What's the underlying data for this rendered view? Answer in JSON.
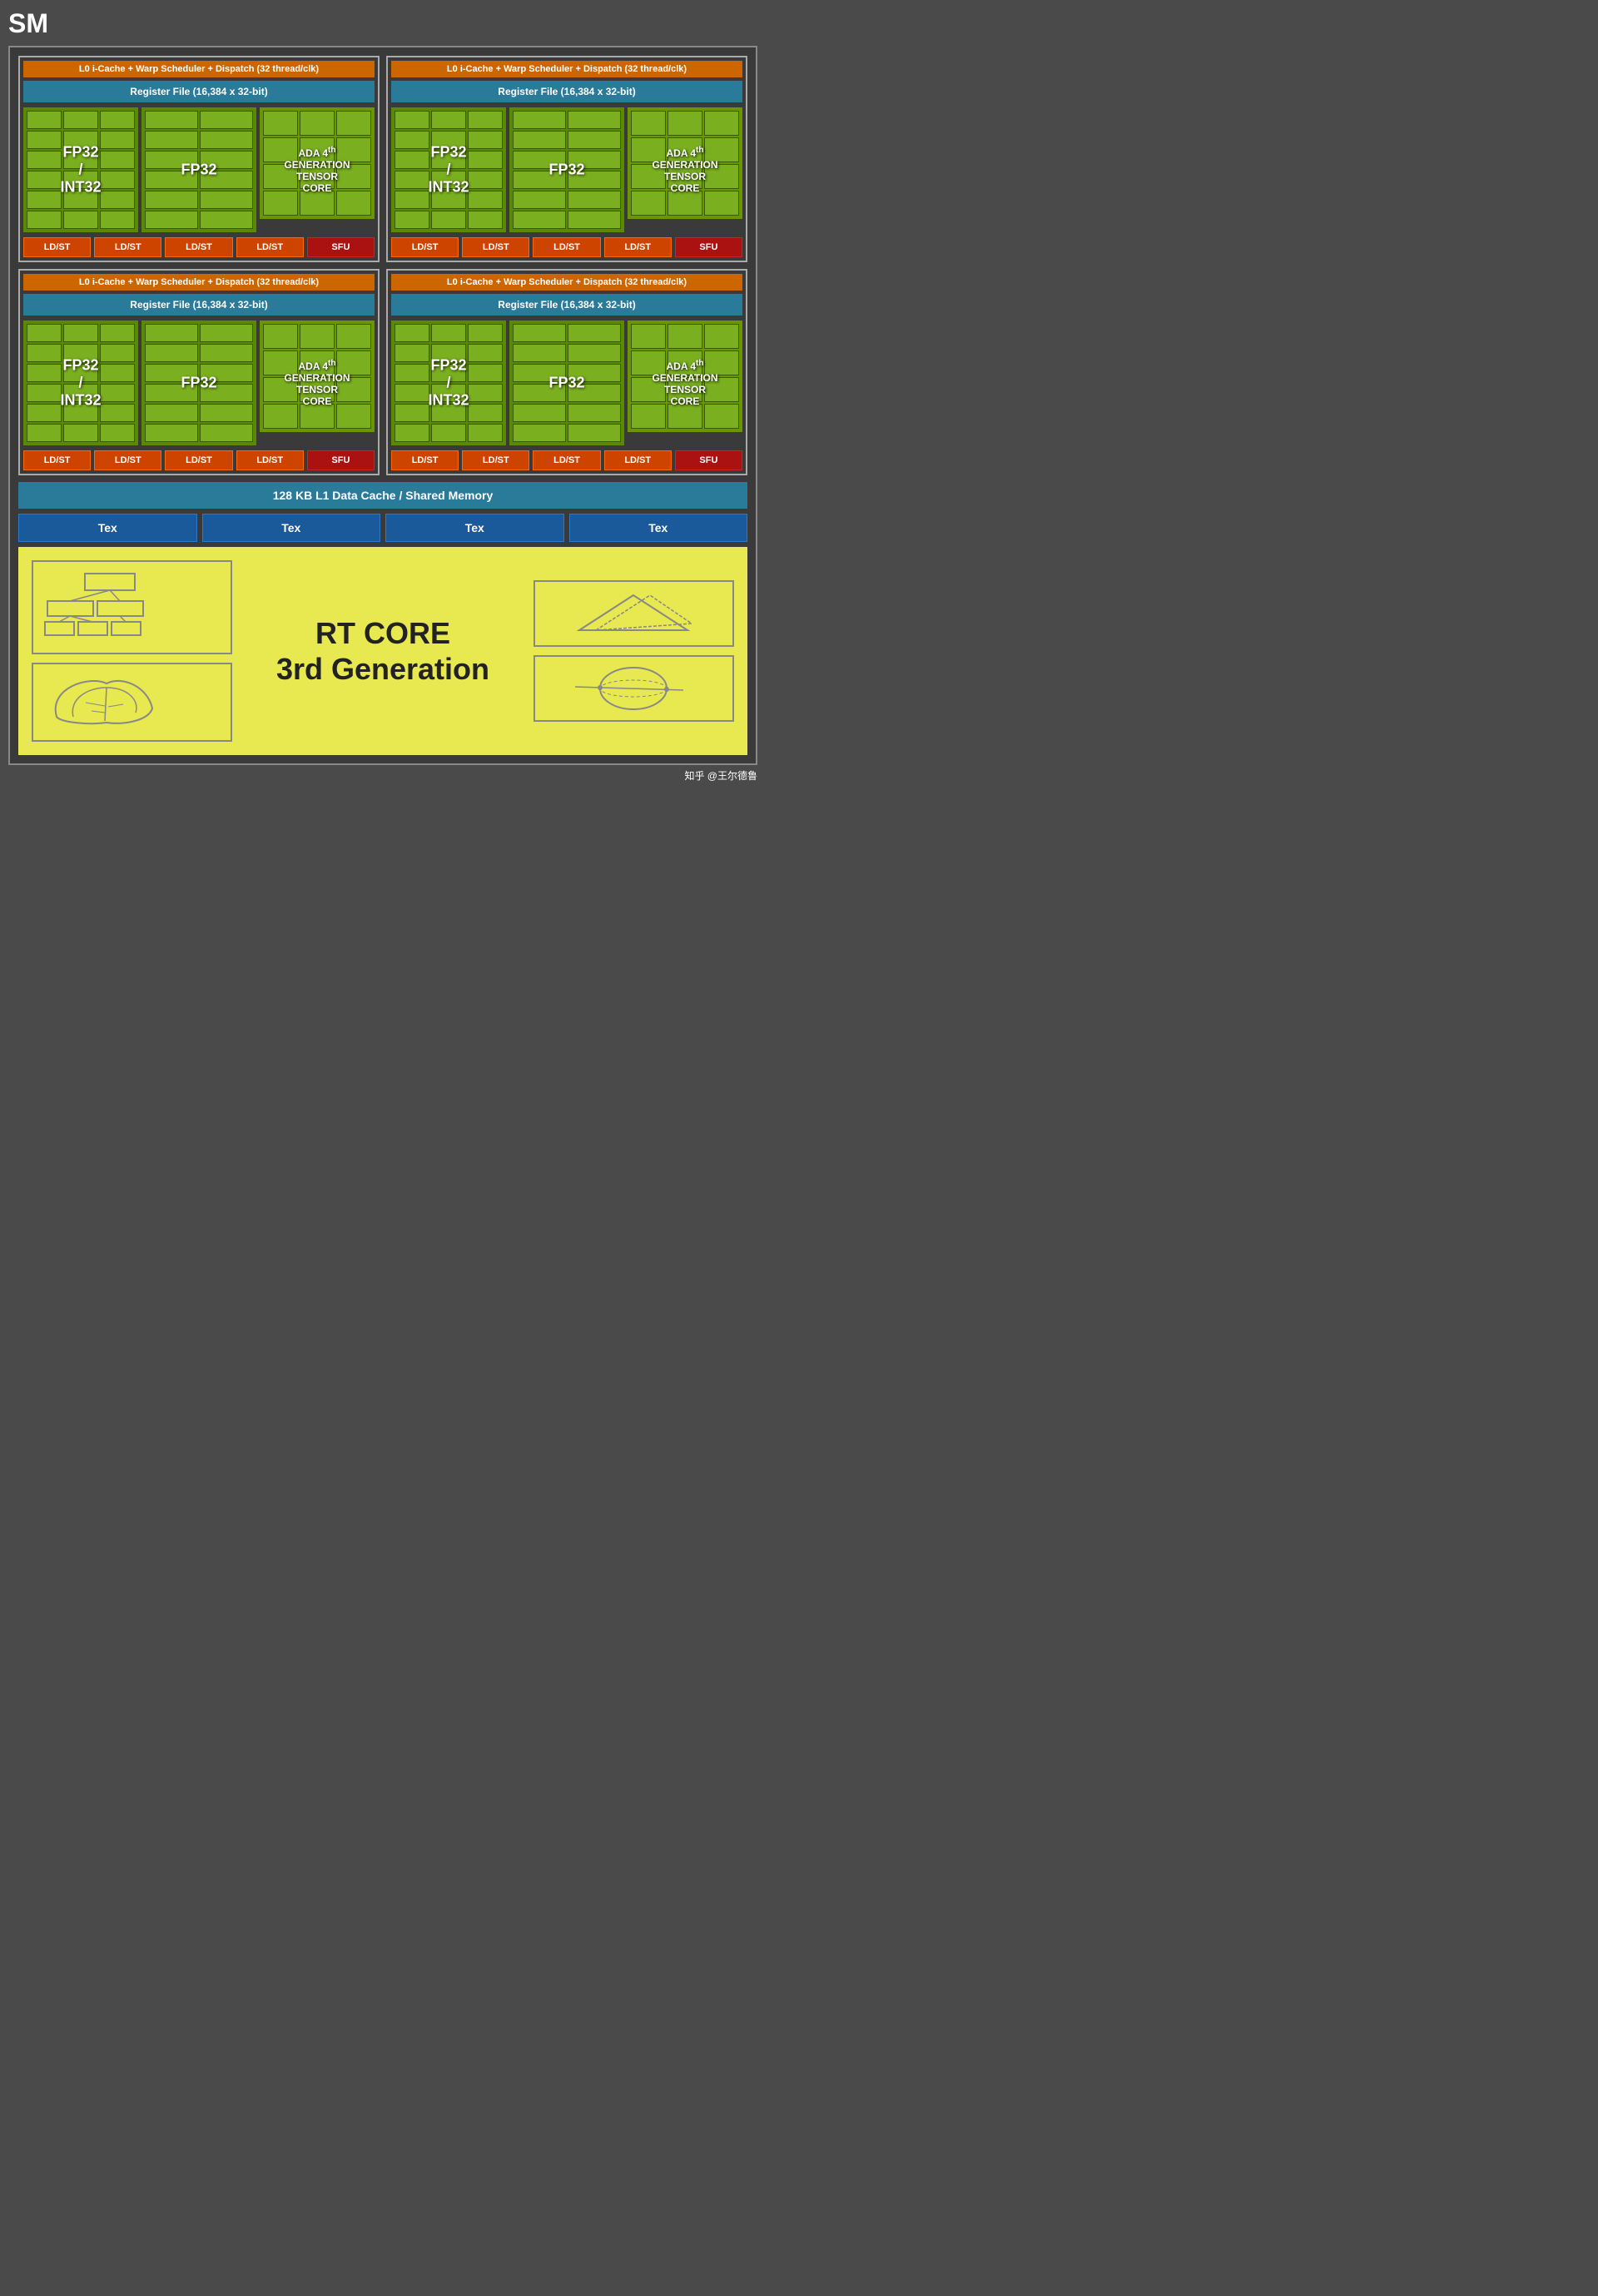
{
  "title": "SM",
  "colors": {
    "warp": "#cc6600",
    "register": "#2a7a9a",
    "green_dark": "#5a8800",
    "green_light": "#7ab020",
    "tensor": "#6a9600",
    "ldst": "#cc4400",
    "sfu": "#aa1111",
    "l1": "#2a7a9a",
    "tex": "#1a5a9a",
    "rt": "#e8e850",
    "border": "#888888"
  },
  "warp_label": "L0 i-Cache + Warp Scheduler + Dispatch (32 thread/clk)",
  "register_label": "Register File (16,384 x 32-bit)",
  "fp32_int32_label": "FP32\n/\nINT32",
  "fp32_label": "FP32",
  "tensor_label": "ADA 4th\nGENERATION\nTENSOR CORE",
  "ldst_labels": [
    "LD/ST",
    "LD/ST",
    "LD/ST",
    "LD/ST"
  ],
  "sfu_label": "SFU",
  "l1_cache_label": "128 KB L1 Data Cache / Shared Memory",
  "tex_labels": [
    "Tex",
    "Tex",
    "Tex",
    "Tex"
  ],
  "rt_core_title": "RT CORE\n3rd Generation",
  "watermark": "知乎 @王尔德鲁"
}
